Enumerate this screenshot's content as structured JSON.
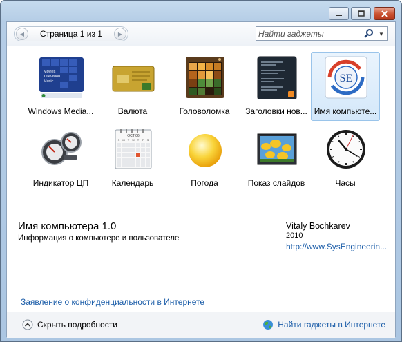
{
  "window": {
    "minimize_label": "minimize",
    "maximize_label": "maximize",
    "close_label": "close"
  },
  "toolbar": {
    "page_label": "Страница 1 из 1",
    "search_placeholder": "Найти гаджеты"
  },
  "gadgets": [
    {
      "name": "Windows Media...",
      "thumb_lines": [
        "Movies",
        "Television",
        "Music"
      ],
      "icon": "windows-media-center-icon"
    },
    {
      "name": "Валюта",
      "icon": "currency-card-icon"
    },
    {
      "name": "Головоломка",
      "icon": "puzzle-icon"
    },
    {
      "name": "Заголовки нов...",
      "icon": "news-headlines-icon"
    },
    {
      "name": "Имя компьюте...",
      "thumb_text": "SE",
      "icon": "computer-name-icon",
      "selected": true
    },
    {
      "name": "Индикатор ЦП",
      "icon": "cpu-meter-icon"
    },
    {
      "name": "Календарь",
      "thumb_month": "OCT 06",
      "thumb_days": [
        "S",
        "M",
        "T",
        "W",
        "T",
        "F",
        "S"
      ],
      "icon": "calendar-icon"
    },
    {
      "name": "Погода",
      "icon": "sun-weather-icon"
    },
    {
      "name": "Показ слайдов",
      "icon": "slideshow-flowers-icon"
    },
    {
      "name": "Часы",
      "icon": "clock-icon"
    }
  ],
  "details": {
    "title": "Имя компьютера 1.0",
    "description": "Информация о компьютере и пользователе",
    "author": "Vitaly Bochkarev",
    "year": "2010",
    "url": "http://www.SysEngineerin..."
  },
  "privacy_link": "Заявление о конфиденциальности в Интернете",
  "footer": {
    "hide_details": "Скрыть подробности",
    "online_gadgets": "Найти гаджеты в Интернете"
  },
  "colors": {
    "link": "#1a5ca8",
    "selection": "#d4e8fa",
    "frame": "#abc6e2"
  }
}
